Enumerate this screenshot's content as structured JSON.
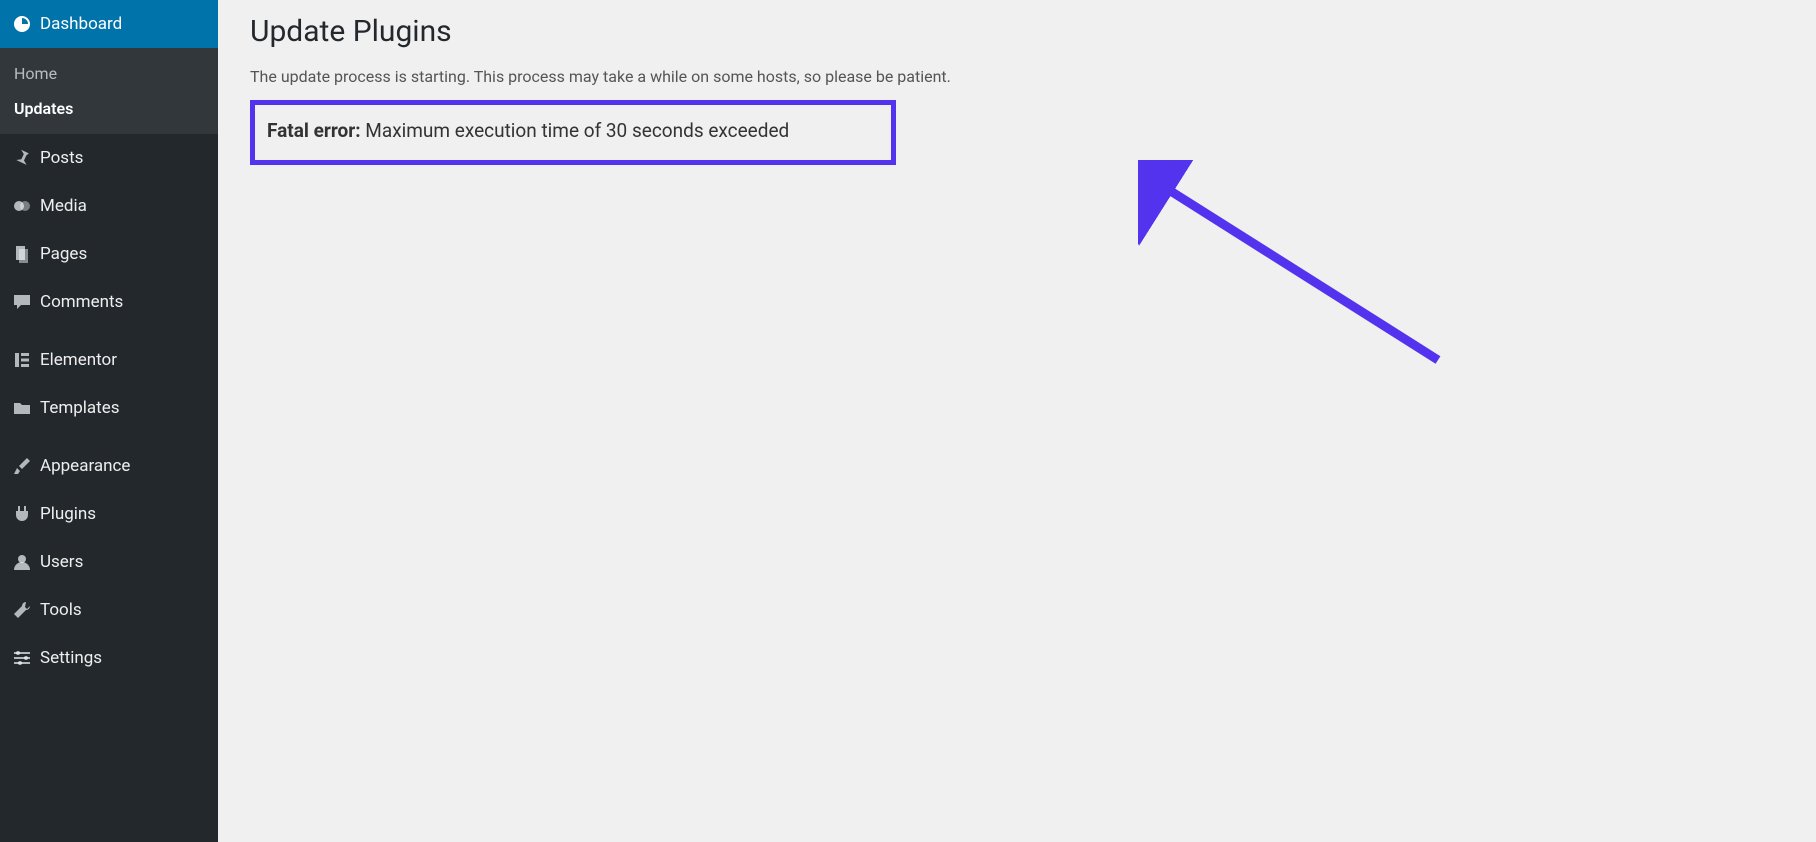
{
  "sidebar": {
    "active": {
      "icon": "dashboard",
      "label": "Dashboard"
    },
    "sub": {
      "items": [
        {
          "label": "Home",
          "active": false
        },
        {
          "label": "Updates",
          "active": true
        }
      ]
    },
    "items": [
      {
        "icon": "pin",
        "label": "Posts"
      },
      {
        "icon": "media",
        "label": "Media"
      },
      {
        "icon": "page",
        "label": "Pages"
      },
      {
        "icon": "comment",
        "label": "Comments"
      },
      {
        "sep": true
      },
      {
        "icon": "elementor",
        "label": "Elementor"
      },
      {
        "icon": "folder",
        "label": "Templates"
      },
      {
        "sep": true
      },
      {
        "icon": "brush",
        "label": "Appearance"
      },
      {
        "icon": "plug",
        "label": "Plugins"
      },
      {
        "icon": "user",
        "label": "Users"
      },
      {
        "icon": "wrench",
        "label": "Tools"
      },
      {
        "icon": "sliders",
        "label": "Settings"
      }
    ]
  },
  "main": {
    "title": "Update Plugins",
    "info": "The update process is starting. This process may take a while on some hosts, so please be patient.",
    "error_label": "Fatal error:",
    "error_msg": " Maximum execution time of 30 seconds exceeded"
  },
  "annotation": {
    "highlight_color": "#5333ed"
  }
}
